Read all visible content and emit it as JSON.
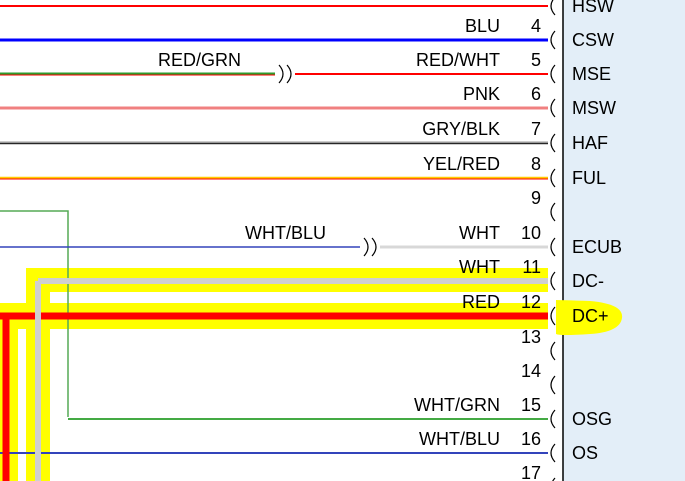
{
  "connector": {
    "background": "#e3eef8",
    "border": "#000000",
    "highlight": "#ffff00"
  },
  "pins": [
    {
      "num": "",
      "label": "HSW",
      "wire": "",
      "wire_color": "#ff0000",
      "near": "",
      "near_color": "",
      "wire_start": "left",
      "highlight": false
    },
    {
      "num": "4",
      "label": "CSW",
      "wire": "BLU",
      "wire_color": "#0000ff",
      "near": "",
      "near_color": "",
      "wire_start": "left",
      "highlight": false
    },
    {
      "num": "5",
      "label": "MSE",
      "wire": "RED/WHT",
      "wire_color": "#ff0000",
      "near": "RED/GRN",
      "near_color": "#2e9b2e",
      "wire_start": "left",
      "highlight": false
    },
    {
      "num": "6",
      "label": "MSW",
      "wire": "PNK",
      "wire_color": "#f08080",
      "near": "",
      "near_color": "",
      "wire_start": "left",
      "highlight": false
    },
    {
      "num": "7",
      "label": "HAF",
      "wire": "GRY/BLK",
      "wire_color": "#999999",
      "near": "",
      "near_color": "",
      "wire_start": "left",
      "highlight": false
    },
    {
      "num": "8",
      "label": "FUL",
      "wire": "YEL/RED",
      "wire_color": "#ffcc00",
      "near": "",
      "near_color": "",
      "wire_start": "left",
      "highlight": false
    },
    {
      "num": "9",
      "label": "",
      "wire": "",
      "wire_color": "",
      "near": "",
      "near_color": "",
      "wire_start": "none",
      "highlight": false
    },
    {
      "num": "10",
      "label": "ECUB",
      "wire": "WHT",
      "wire_color": "#d8d8d8",
      "near": "WHT/BLU",
      "near_color": "#3344bb",
      "wire_start": "left",
      "highlight": false
    },
    {
      "num": "11",
      "label": "DC-",
      "wire": "WHT",
      "wire_color": "#d0d0d0",
      "near": "",
      "near_color": "",
      "wire_start": "bend",
      "highlight": true
    },
    {
      "num": "12",
      "label": "DC+",
      "wire": "RED",
      "wire_color": "#ff0000",
      "near": "",
      "near_color": "",
      "wire_start": "left",
      "highlight": true
    },
    {
      "num": "13",
      "label": "",
      "wire": "",
      "wire_color": "",
      "near": "",
      "near_color": "",
      "wire_start": "none",
      "highlight": false
    },
    {
      "num": "14",
      "label": "",
      "wire": "",
      "wire_color": "",
      "near": "",
      "near_color": "",
      "wire_start": "none",
      "highlight": false
    },
    {
      "num": "15",
      "label": "OSG",
      "wire": "WHT/GRN",
      "wire_color": "#44aa44",
      "near": "",
      "near_color": "",
      "wire_start": "bend",
      "highlight": false
    },
    {
      "num": "16",
      "label": "OS",
      "wire": "WHT/BLU",
      "wire_color": "#3344bb",
      "near": "",
      "near_color": "",
      "wire_start": "left",
      "highlight": false
    },
    {
      "num": "17",
      "label": "",
      "wire": "",
      "wire_color": "",
      "near": "",
      "near_color": "",
      "wire_start": "none",
      "highlight": false
    }
  ]
}
